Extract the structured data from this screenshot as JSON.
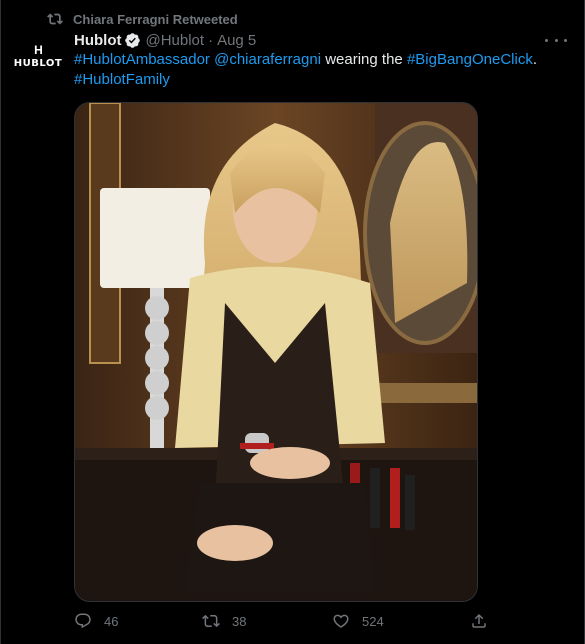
{
  "retweet_banner": {
    "text": "Chiara Ferragni Retweeted",
    "icon": "retweet-icon"
  },
  "author": {
    "display_name": "Hublot",
    "handle": "@Hublot",
    "separator": "·",
    "date": "Aug 5",
    "verified": true,
    "avatar_logo": "HUBLOT",
    "avatar_mark": "H"
  },
  "tweet": {
    "part1_link": "#HublotAmbassador",
    "part2_link": "@chiaraferragni",
    "part3_text": " wearing the ",
    "part4_link": "#BigBangOneClick",
    "part5_text": ".",
    "part6_link": "#HublotFamily"
  },
  "media": {
    "kind": "photo",
    "icon": "photo"
  },
  "actions": {
    "replies": "46",
    "retweets": "38",
    "likes": "524"
  },
  "colors": {
    "background": "#000000",
    "text": "#e7e9ea",
    "muted": "#71767b",
    "link": "#1d9bf0",
    "verified": "#e7e9ea"
  }
}
